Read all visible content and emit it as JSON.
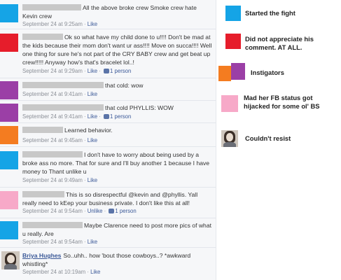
{
  "colors": {
    "started": "#15a4e6",
    "not_appreciate": "#e61d2b",
    "instigator_orange": "#f47c20",
    "instigator_purple": "#9b3fa6",
    "hijacked": "#f7a9c8",
    "link": "#3b5998"
  },
  "comments": [
    {
      "text": "All the above broke crew Smoke crew hate Kevin crew",
      "time": "September 24 at 9:25am",
      "like": "Like",
      "people": ""
    },
    {
      "text": "Ok so what have my child done to u!!!! Don't be mad at the kids because their mom don't want ur ass!!!! Move on succa!!!! Well one thing for sure he's not part of the CRY BABY crew and get beat up crew!!!!! Anyway how's that's bracelet lol..!",
      "time": "September 24 at 9:29am",
      "like": "Like",
      "people": "1 person"
    },
    {
      "text": "that cold: wow",
      "time": "September 24 at 9:41am",
      "like": "Like",
      "people": ""
    },
    {
      "text": "that cold PHYLLIS: WOW",
      "time": "September 24 at 9:41am",
      "like": "Like",
      "people": "1 person"
    },
    {
      "text": "Learned behavior.",
      "time": "September 24 at 9:45am",
      "like": "Like",
      "people": ""
    },
    {
      "text": "I don't have to worry about being used by a broke ass no more. That for sure and I'll buy another 1 because I have money to Thant unlike u",
      "time": "September 24 at 9:49am",
      "like": "Like",
      "people": ""
    },
    {
      "text": "This is so disrespectful @kevin and @phyllis. Yall really need to kEep your business private. I don't like this at all!",
      "time": "September 24 at 9:54am",
      "like": "Unlike",
      "people": "1 person"
    },
    {
      "text": "Maybe Clarence need to post more pics of what u really. Are",
      "time": "September 24 at 9:54am",
      "like": "Like",
      "people": ""
    },
    {
      "author": "Briya Hughes",
      "text": "So..uhh.. how 'bout those cowboys..? *awkward whistling*",
      "time": "September 24 at 10:19am",
      "like": "Like",
      "people": ""
    }
  ],
  "legend": [
    {
      "label": "Started the fight"
    },
    {
      "label": "Did not appreciate his comment. AT ALL."
    },
    {
      "label": "Instigators"
    },
    {
      "label": "Mad her FB status got hijacked for some ol' BS"
    },
    {
      "label": "Couldn't resist"
    }
  ]
}
